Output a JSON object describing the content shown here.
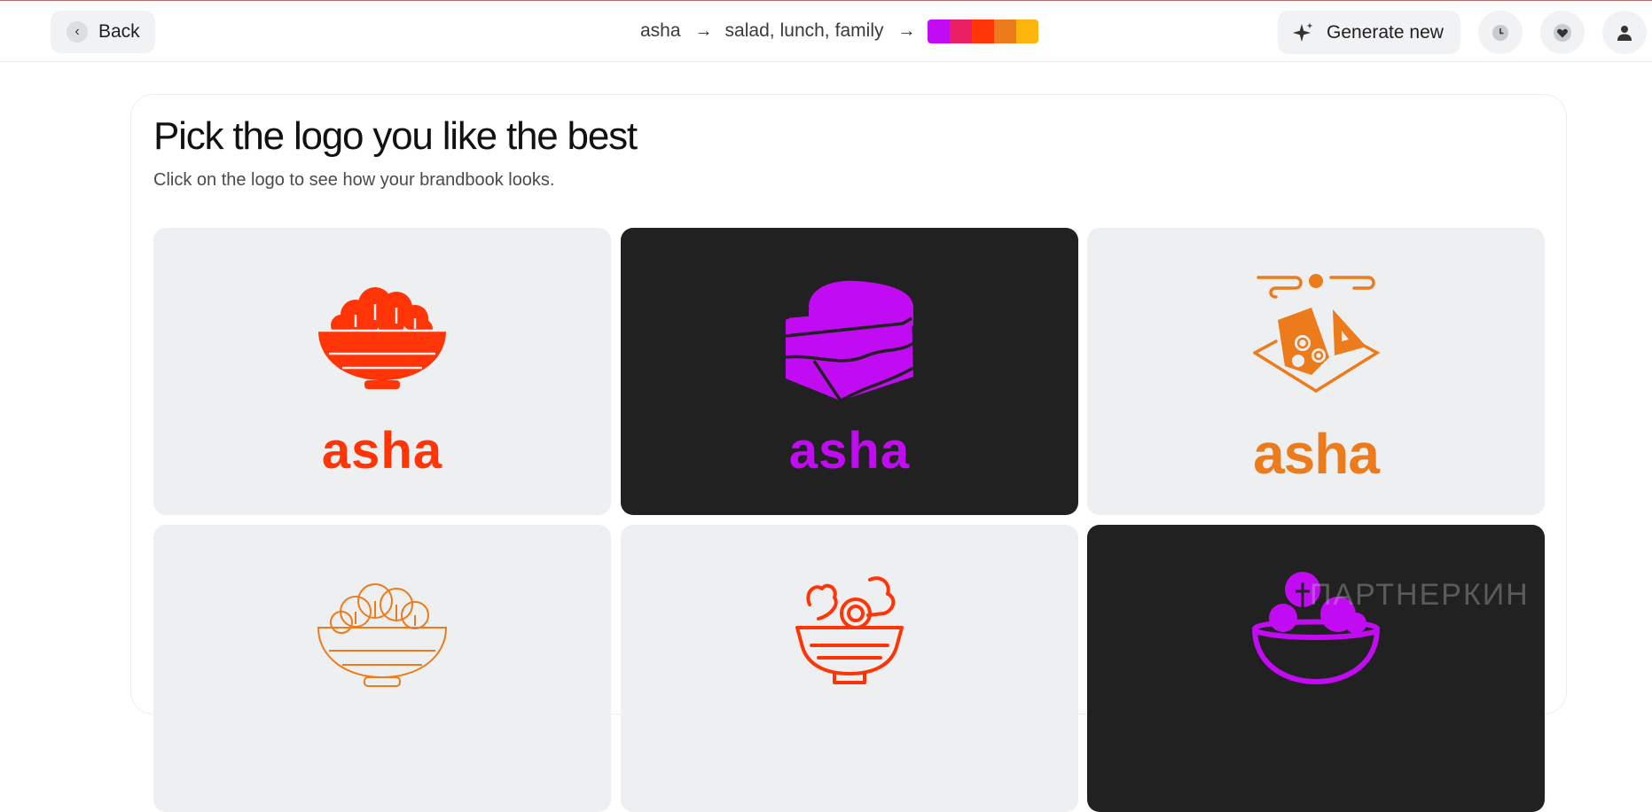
{
  "header": {
    "back_label": "Back",
    "brand_name": "asha",
    "keywords": [
      "salad,",
      "lunch,",
      "family"
    ],
    "arrow_glyph": "→",
    "palette": [
      "#c10bf2",
      "#ea1e63",
      "#ff3407",
      "#ec7b1c",
      "#fdb50e"
    ],
    "generate_label": "Generate new",
    "icons": [
      "back-chevron-icon",
      "sparkle-icon",
      "history-clock-icon",
      "favorites-heart-icon",
      "user-profile-icon"
    ]
  },
  "main": {
    "title": "Pick the logo you like the best",
    "subtitle": "Click on the logo to see how your brandbook looks."
  },
  "logos": [
    {
      "wordmark": "asha",
      "theme": "light",
      "color": "#ff3407",
      "icon": "salad-bowl-icon"
    },
    {
      "wordmark": "asha",
      "theme": "dark",
      "color": "#c10bf2",
      "icon": "sandwich-icon"
    },
    {
      "wordmark": "asha",
      "theme": "light",
      "color": "#ec7b1c",
      "icon": "nachos-plate-icon"
    },
    {
      "wordmark": "",
      "theme": "light",
      "color": "#ec7b1c",
      "icon": "outline-salad-bowl-icon"
    },
    {
      "wordmark": "",
      "theme": "light",
      "color": "#ff3407",
      "icon": "salad-bowl-line-icon"
    },
    {
      "wordmark": "",
      "theme": "dark",
      "color": "#c10bf2",
      "icon": "bowl-with-greens-icon"
    }
  ],
  "watermark": "ПАРТНЕРКИН"
}
